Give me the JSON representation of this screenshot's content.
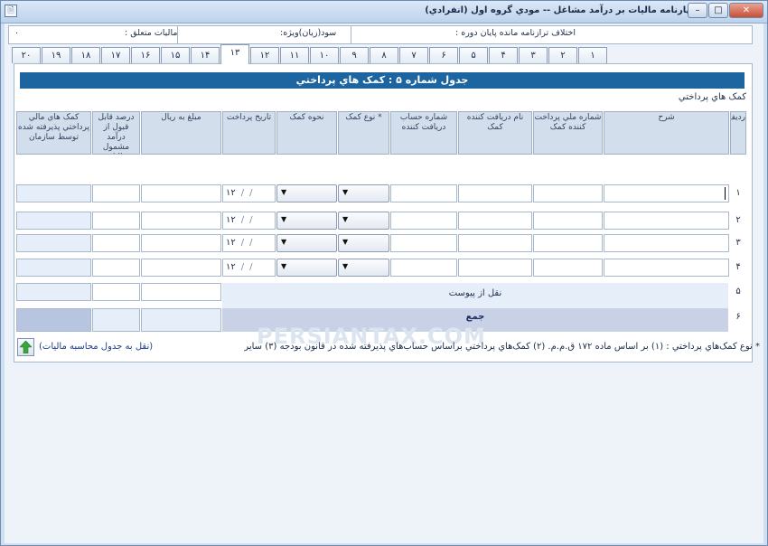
{
  "window": {
    "title": "اظهارنامه ماليات بر درآمد مشاغل -- مودي گروه اول (انفرادي)",
    "icon_glyph": "🗎",
    "controls": {
      "minimize": "–",
      "maximize": "□",
      "close": "✕"
    }
  },
  "info_row": {
    "taxes_due_label": "ماليات متعلق :",
    "taxes_due_value": "۰",
    "profit_label": "سود(زيان)ويژه:",
    "balance_diff_label": "اختلاف ترازنامه مانده پايان دوره :"
  },
  "tabs": [
    "۱",
    "۲",
    "۳",
    "۴",
    "۵",
    "۶",
    "۷",
    "۸",
    "۹",
    "۱۰",
    "۱۱",
    "۱۲",
    "۱۳",
    "۱۴",
    "۱۵",
    "۱۶",
    "۱۷",
    "۱۸",
    "۱۹",
    "۲۰"
  ],
  "active_tab": "۱۳",
  "table": {
    "banner": "جدول شماره ۵ : کمک هاي پرداختي",
    "subtitle": "کمک هاي پرداختي",
    "headers": {
      "row_no": "رديف",
      "description": "شرح",
      "payer_id": "شماره ملي پرداخت کننده کمک",
      "recipient_name": "نام دريافت کننده کمک",
      "recipient_account": "شماره حساب دريافت کننده",
      "aid_type": "* نوع کمک",
      "aid_method": "نحوه کمک",
      "payment_date": "تاريخ پرداخت",
      "amount": "مبلغ به ريال",
      "deductible_percent": "درصد قابل قبول از درآمد مشمول ماليات",
      "accepted_by_org": "کمک هاي مالي پرداختي پذيرفته شده توسط سازمان"
    },
    "row_numbers": [
      "۱",
      "۲",
      "۳",
      "۴",
      "۵",
      "۶"
    ],
    "date_year": "۱۲",
    "date_sep": "/",
    "row5_label": "نقل از پيوست",
    "row6_label": "جمع",
    "dropdown_arrow": "▼"
  },
  "watermark": "PERSIANTAX.COM",
  "footnote": "* نوع کمک‌هاي پرداختي : (۱) بر اساس ماده ۱۷۲ ق.م.م. (۲) کمک‌هاي پرداختي براساس حساب‌هاي پذيرفته شده در قانون بودجه (۳) ساير",
  "transfer_link": "(نقل به جدول محاسبه ماليات)",
  "colors": {
    "banner": "#1c65a0",
    "header_bg": "#d3deec",
    "sum_bg": "#c8d1e6",
    "arrow_green": "#3aa53a"
  }
}
